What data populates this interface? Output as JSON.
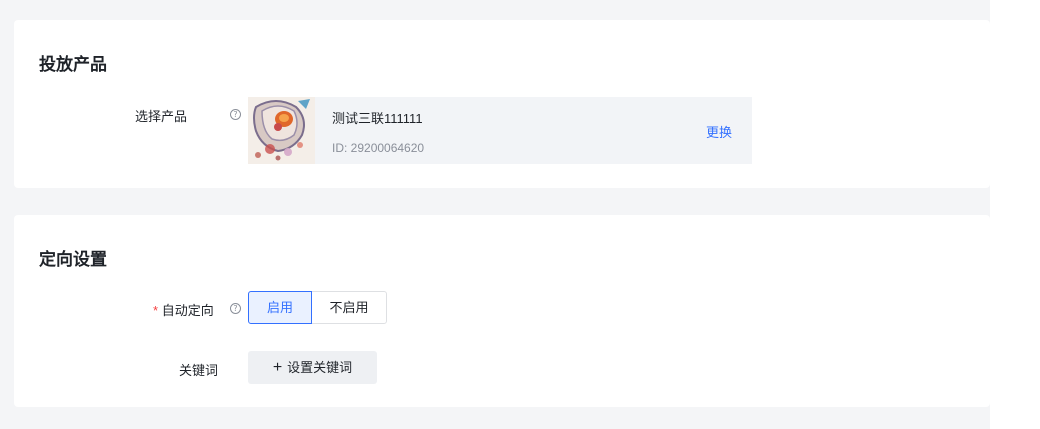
{
  "product_section": {
    "title": "投放产品",
    "select_label": "选择产品",
    "help_glyph": "?",
    "product": {
      "name": "测试三联111111",
      "id_text": "ID: 29200064620",
      "thumbnail_icon": "product-image"
    },
    "change_label": "更换"
  },
  "targeting_section": {
    "title": "定向设置",
    "auto_label": "自动定向",
    "required_mark": "*",
    "help_glyph": "?",
    "options": [
      "启用",
      "不启用"
    ],
    "selected_option": "启用",
    "keyword_label": "关键词",
    "keyword_button_icon": "+",
    "keyword_button_label": "设置关键词"
  },
  "colors": {
    "accent": "#3370ff",
    "required": "#f53f3f",
    "page_bg": "#f4f5f7"
  }
}
